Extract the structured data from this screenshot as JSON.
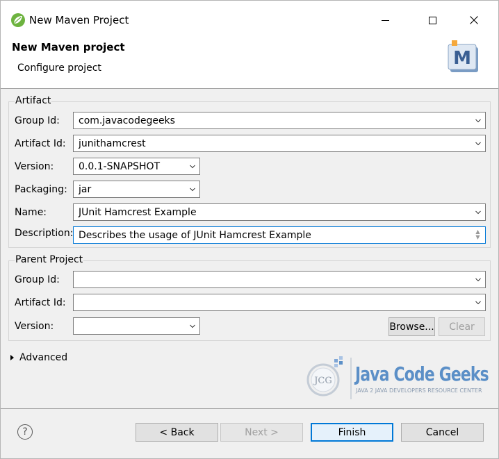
{
  "window": {
    "title": "New Maven Project"
  },
  "header": {
    "title": "New Maven project",
    "subtitle": "Configure project",
    "logo_letter": "M"
  },
  "artifact": {
    "group_label": "Artifact",
    "group_id": {
      "label": "Group Id:",
      "value": "com.javacodegeeks"
    },
    "artifact_id": {
      "label": "Artifact Id:",
      "value": "junithamcrest"
    },
    "version": {
      "label": "Version:",
      "value": "0.0.1-SNAPSHOT"
    },
    "packaging": {
      "label": "Packaging:",
      "value": "jar"
    },
    "name": {
      "label": "Name:",
      "value": "JUnit Hamcrest Example"
    },
    "description": {
      "label": "Description:",
      "value": "Describes the usage of JUnit Hamcrest Example"
    }
  },
  "parent": {
    "group_label": "Parent Project",
    "group_id": {
      "label": "Group Id:",
      "value": ""
    },
    "artifact_id": {
      "label": "Artifact Id:",
      "value": ""
    },
    "version": {
      "label": "Version:",
      "value": ""
    },
    "browse_label": "Browse...",
    "clear_label": "Clear"
  },
  "advanced_label": "Advanced",
  "watermark": {
    "brand": "Java Code Geeks",
    "tagline": "JAVA 2 JAVA DEVELOPERS RESOURCE CENTER",
    "badge": "JCG"
  },
  "footer": {
    "back": "< Back",
    "next": "Next >",
    "finish": "Finish",
    "cancel": "Cancel",
    "help": "?"
  },
  "colors": {
    "accent": "#0078d7",
    "brand": "#5b8fc7"
  },
  "icons": [
    "spring-leaf-icon",
    "minimize-icon",
    "maximize-icon",
    "close-icon",
    "maven-logo-icon",
    "chevron-down-icon",
    "expand-triangle-icon",
    "help-icon"
  ]
}
